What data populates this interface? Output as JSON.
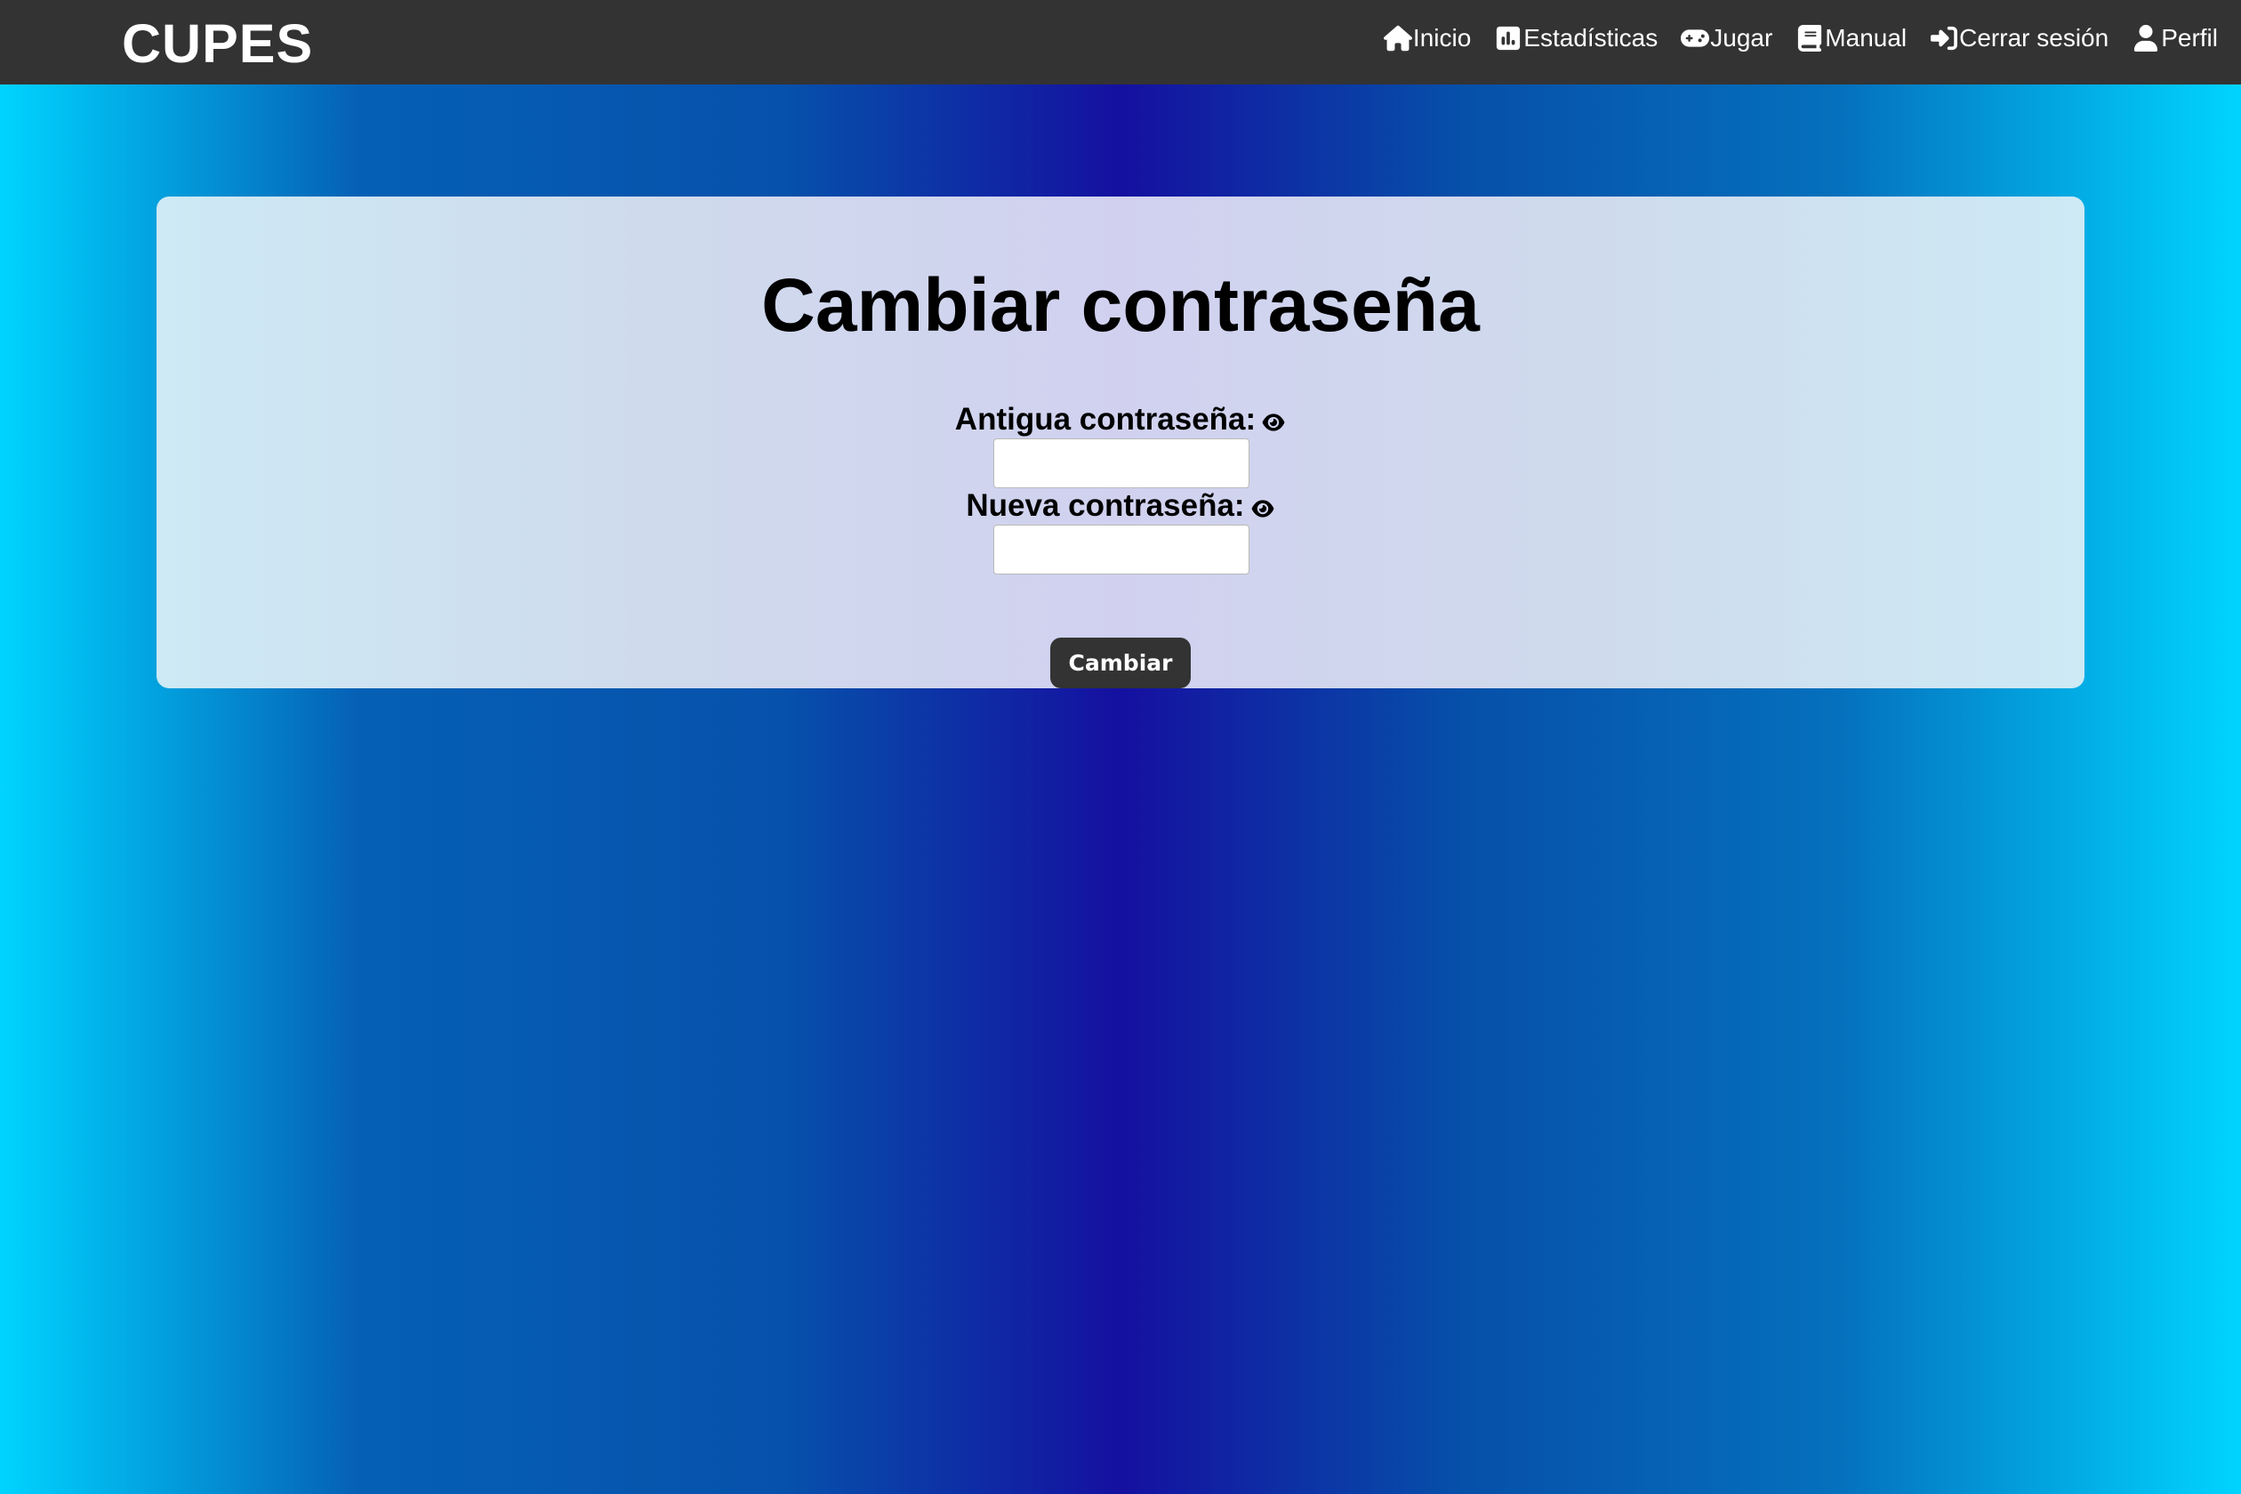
{
  "navbar": {
    "brand": "CUPES",
    "items": [
      {
        "label": "Inicio",
        "icon": "home-icon"
      },
      {
        "label": "Estadísticas",
        "icon": "chart-bar-icon"
      },
      {
        "label": "Jugar",
        "icon": "gamepad-icon"
      },
      {
        "label": "Manual",
        "icon": "book-icon"
      },
      {
        "label": "Cerrar sesión",
        "icon": "sign-in-arrow-icon"
      },
      {
        "label": "Perfil",
        "icon": "user-icon"
      }
    ]
  },
  "form": {
    "title": "Cambiar contraseña",
    "old_password": {
      "label": "Antigua contraseña:",
      "value": "",
      "toggle_icon": "eye-icon"
    },
    "new_password": {
      "label": "Nueva contraseña:",
      "value": "",
      "toggle_icon": "eye-icon"
    },
    "submit_label": "Cambiar"
  },
  "colors": {
    "navbar_bg": "#333333",
    "button_bg": "#333333",
    "gradient_edge": "#00d4ff",
    "gradient_center": "#1510a0"
  }
}
